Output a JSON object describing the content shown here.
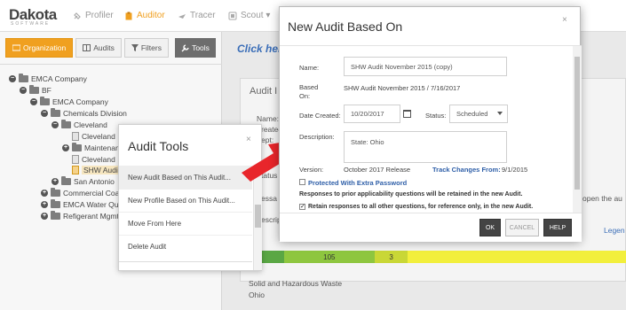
{
  "nav": {
    "logo": "Dakota",
    "logo_sub": "SOFTWARE",
    "items": [
      {
        "label": "Profiler"
      },
      {
        "label": "Auditor"
      },
      {
        "label": "Tracer"
      },
      {
        "label": "Scout ▾"
      }
    ]
  },
  "left": {
    "tabs": [
      {
        "label": "Organization"
      },
      {
        "label": "Audits"
      },
      {
        "label": "Filters"
      }
    ],
    "tools_label": "Tools",
    "tree": [
      {
        "label": "EMCA Company"
      },
      {
        "label": "BF"
      },
      {
        "label": "EMCA Company"
      },
      {
        "label": "Chemicals Division"
      },
      {
        "label": "Cleveland"
      },
      {
        "label": "Cleveland"
      },
      {
        "label": "Maintenan"
      },
      {
        "label": "Cleveland"
      },
      {
        "label": "SHW Audi"
      },
      {
        "label": "San Antonio"
      },
      {
        "label": "Commercial Coa"
      },
      {
        "label": "EMCA Water Qua"
      },
      {
        "label": "Refigerant Mgmt"
      }
    ]
  },
  "main": {
    "click_here": "Click here",
    "audit_title": "Audit I",
    "name_label": "Name:",
    "created_label": "reated",
    "dept_label": "ept:",
    "status_label": "tatus",
    "message_label": "essa",
    "descrip_label": "escrip",
    "open_text": "open the au",
    "legend_link": "Legen",
    "progress": [
      {
        "label": "",
        "pct": 6,
        "color": "#5aa744"
      },
      {
        "label": "105",
        "pct": 25,
        "color": "#8ec63f"
      },
      {
        "label": "3",
        "pct": 9,
        "color": "#c9d736"
      },
      {
        "label": "",
        "pct": 60,
        "color": "#f2ef3c"
      }
    ],
    "foot_line1": "Solid and Hazardous Waste",
    "foot_line2": "Ohio"
  },
  "tools_popup": {
    "title": "Audit Tools",
    "close": "×",
    "items": [
      {
        "label": "New Audit Based on This Audit..."
      },
      {
        "label": "New Profile Based on This Audit..."
      },
      {
        "label": "Move From Here"
      },
      {
        "label": "Delete Audit"
      }
    ]
  },
  "dialog": {
    "title": "New Audit Based On",
    "close": "×",
    "name_label": "Name:",
    "name_value": "SHW Audit November 2015 (copy)",
    "based_on_label": "Based On:",
    "based_on_value": "SHW Audit November 2015   /  7/16/2017",
    "date_label": "Date Created:",
    "date_value": "10/20/2017",
    "status_label": "Status:",
    "status_value": "Scheduled",
    "description_label": "Description:",
    "description_value": "State: Ohio",
    "version_label": "Version:",
    "version_value": "October 2017 Release",
    "track_changes_label": "Track Changes From:",
    "track_changes_value": "9/1/2015",
    "protected_label": "Protected With Extra Password",
    "note1": "Responses to prior applicability questions will be retained in the new Audit.",
    "retain_label": "Retain responses to all other questions, for reference only, in the new Audit.",
    "ok_label": "OK",
    "cancel_label": "CANCEL",
    "help_label": "HELP",
    "colors": {
      "arrow": "#e8262b",
      "accent": "#f0a020",
      "link": "#2f5fa8"
    }
  }
}
